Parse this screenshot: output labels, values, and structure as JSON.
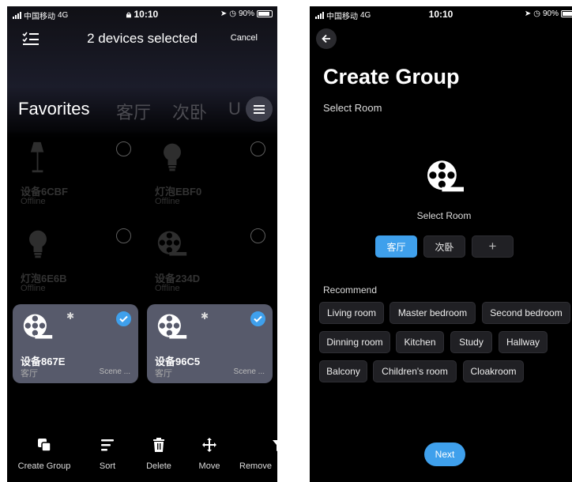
{
  "left": {
    "status": {
      "carrier": "中国移动",
      "network": "4G",
      "time": "10:10",
      "battery": "90%"
    },
    "header": {
      "title": "2 devices selected",
      "cancel_label": "Cancel"
    },
    "tabs": [
      {
        "label": "Favorites",
        "active": true
      },
      {
        "label": "客厅",
        "active": false
      },
      {
        "label": "次卧",
        "active": false
      },
      {
        "label": "U",
        "active": false
      }
    ],
    "devices": [
      {
        "name": "设备6CBF",
        "status": "Offline",
        "icon": "floor-lamp-icon",
        "selected": false
      },
      {
        "name": "灯泡EBF0",
        "status": "Offline",
        "icon": "bulb-icon",
        "selected": false
      },
      {
        "name": "灯泡6E6B",
        "status": "Offline",
        "icon": "bulb-icon",
        "selected": false
      },
      {
        "name": "设备234D",
        "status": "Offline",
        "icon": "film-reel-icon",
        "selected": false
      },
      {
        "name": "设备867E",
        "status": "客厅",
        "scene": "Scene ...",
        "icon": "film-reel-icon",
        "selected": true
      },
      {
        "name": "设备96C5",
        "status": "客厅",
        "scene": "Scene ...",
        "icon": "film-reel-icon",
        "selected": true
      }
    ],
    "toolbar": [
      {
        "label": "Create Group",
        "icon": "create-group-icon"
      },
      {
        "label": "Sort",
        "icon": "sort-icon"
      },
      {
        "label": "Delete",
        "icon": "trash-icon"
      },
      {
        "label": "Move",
        "icon": "move-icon"
      },
      {
        "label": "Remove",
        "icon": "remove-icon"
      }
    ]
  },
  "right": {
    "status": {
      "carrier": "中国移动",
      "network": "4G",
      "time": "10:10",
      "battery": "90%"
    },
    "title": "Create Group",
    "subtitle": "Select Room",
    "room_label": "Select Room",
    "rooms": [
      {
        "label": "客厅",
        "active": true
      },
      {
        "label": "次卧",
        "active": false
      }
    ],
    "add_label": "+",
    "recommend_label": "Recommend",
    "recommend": [
      "Living room",
      "Master bedroom",
      "Second bedroom",
      "Dinning room",
      "Kitchen",
      "Study",
      "Hallway",
      "Balcony",
      "Children's room",
      "Cloakroom"
    ],
    "next_label": "Next"
  },
  "colors": {
    "accent": "#3fa0ec",
    "card_selected": "#575a6b",
    "chip": "#202024",
    "background": "#000000"
  }
}
